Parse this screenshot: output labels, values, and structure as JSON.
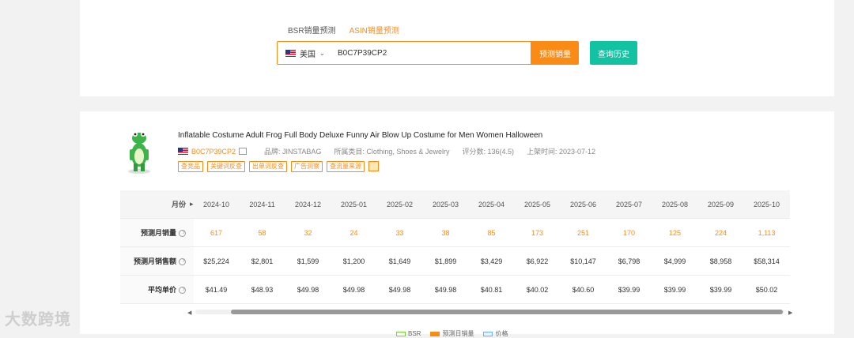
{
  "search": {
    "tabs": [
      {
        "label": "BSR销量预测"
      },
      {
        "label": "ASIN销量预测"
      }
    ],
    "country": "美国",
    "asin_value": "B0C7P39CP2",
    "predict_button": "预测销量",
    "history_button": "查询历史"
  },
  "product": {
    "title": "Inflatable Costume Adult Frog Full Body Deluxe Funny Air Blow Up Costume for Men Women Halloween",
    "asin": "B0C7P39CP2",
    "brand": "品牌: JINSTABAG",
    "category": "所属类目: Clothing, Shoes & Jewelry",
    "rating": "评分数: 136(4.5)",
    "listed": "上架时间: 2023-07-12",
    "tags": [
      "查竞品",
      "关键词反查",
      "出单词反查",
      "广告洞察",
      "查流量来源"
    ]
  },
  "table": {
    "month_label": "月份",
    "months": [
      "2024-10",
      "2024-11",
      "2024-12",
      "2025-01",
      "2025-02",
      "2025-03",
      "2025-04",
      "2025-05",
      "2025-06",
      "2025-07",
      "2025-08",
      "2025-09",
      "2025-10"
    ],
    "rows": [
      {
        "label": "预测月销量",
        "values": [
          "617",
          "58",
          "32",
          "24",
          "33",
          "38",
          "85",
          "173",
          "251",
          "170",
          "125",
          "224",
          "1,113"
        ]
      },
      {
        "label": "预测月销售额",
        "values": [
          "$25,224",
          "$2,801",
          "$1,599",
          "$1,200",
          "$1,649",
          "$1,899",
          "$3,429",
          "$6,922",
          "$10,147",
          "$6,798",
          "$4,999",
          "$8,958",
          "$58,314"
        ]
      },
      {
        "label": "平均单价",
        "values": [
          "$41.49",
          "$48.93",
          "$49.98",
          "$49.98",
          "$49.98",
          "$49.98",
          "$40.81",
          "$40.02",
          "$40.60",
          "$39.99",
          "$39.99",
          "$39.99",
          "$50.02"
        ]
      }
    ]
  },
  "legend": [
    {
      "label": "BSR",
      "color": "#b7eb8f"
    },
    {
      "label": "预测日销量",
      "color": "#fa8c16"
    },
    {
      "label": "价格",
      "color": "#91caff"
    }
  ],
  "watermark": "大数跨境",
  "colors": {
    "accent": "#fa8c16",
    "teal": "#13c2a3"
  }
}
